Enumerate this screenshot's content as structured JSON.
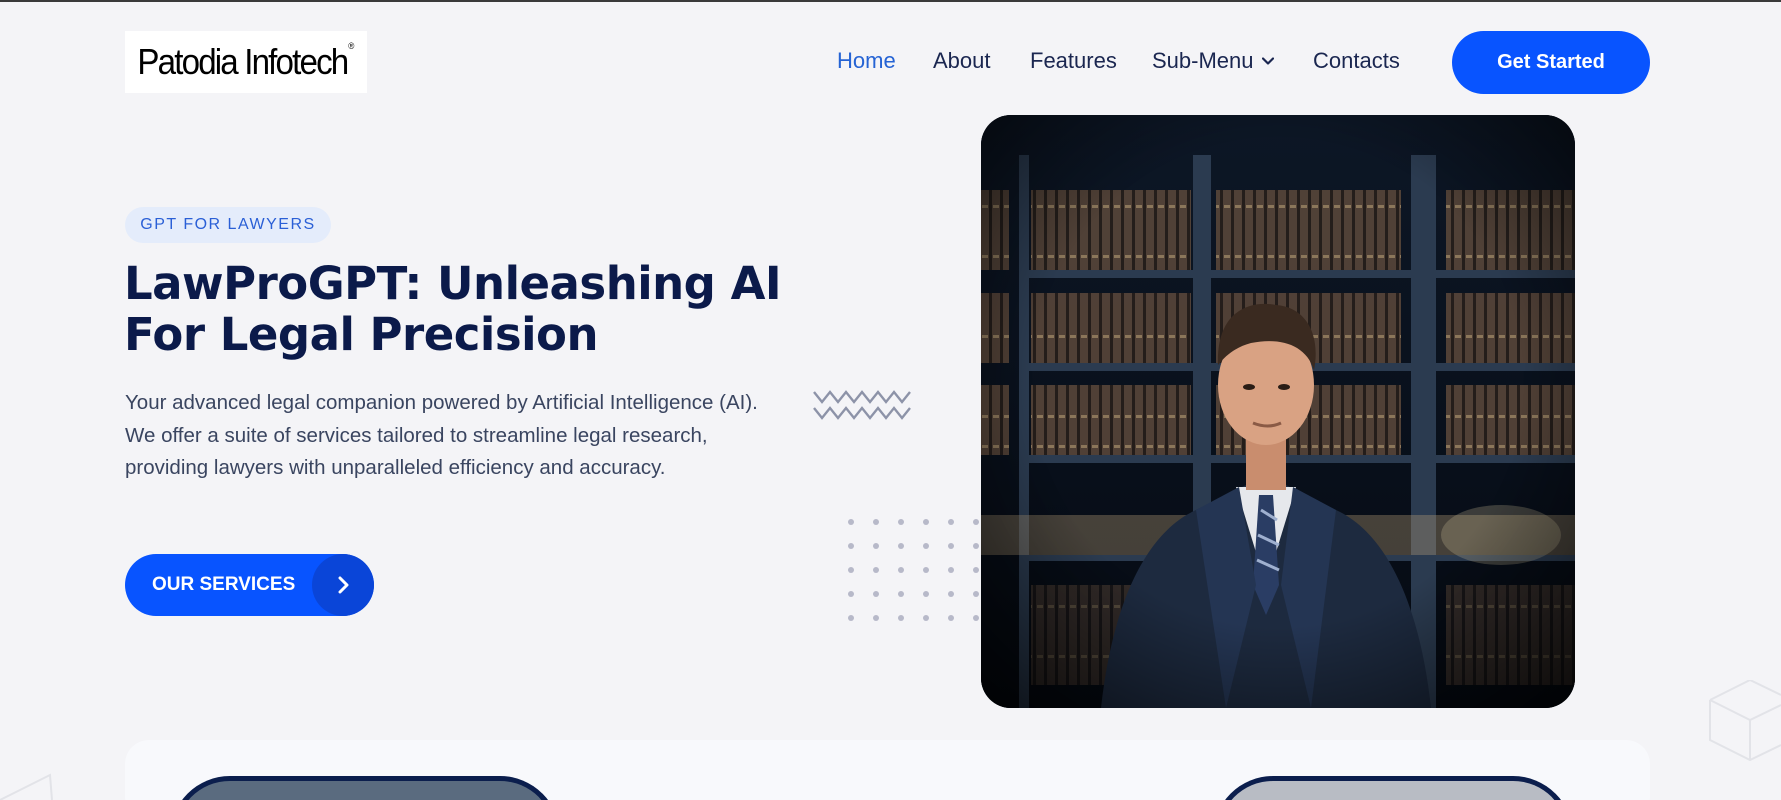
{
  "header": {
    "logo_text": "Patodia Infotech",
    "logo_mark": "®",
    "nav": [
      {
        "label": "Home",
        "active": true
      },
      {
        "label": "About",
        "active": false
      },
      {
        "label": "Features",
        "active": false
      },
      {
        "label": "Sub-Menu",
        "active": false,
        "icon": "chevron-down-icon"
      },
      {
        "label": "Contacts",
        "active": false
      }
    ],
    "cta_label": "Get Started"
  },
  "hero": {
    "badge": "GPT FOR LAWYERS",
    "title_line1": "LawProGPT: Unleashing AI",
    "title_line2": "For Legal Precision",
    "description": "Your advanced legal companion powered by Artificial Intelligence (AI). We offer a suite of services tailored to streamline legal research, providing lawyers with unparalleled efficiency and accuracy.",
    "button_label": "OUR SERVICES",
    "button_icon": "chevron-right-icon",
    "image": "lawyer-in-library-photo"
  },
  "colors": {
    "accent": "#0854ff",
    "heading": "#0b1a4a",
    "active_nav": "#2563d4",
    "badge_bg": "#e4ecfb",
    "background": "#f4f4f7"
  }
}
